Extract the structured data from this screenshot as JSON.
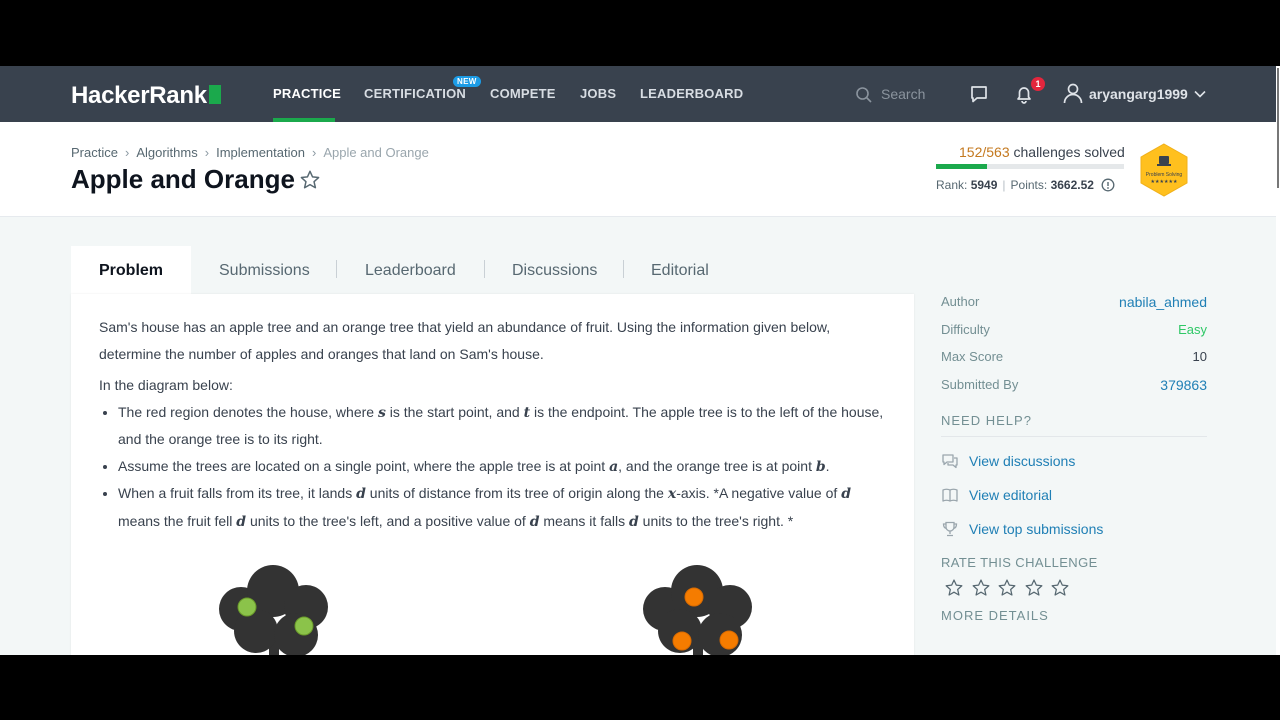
{
  "nav": {
    "logo": "HackerRank",
    "items": [
      "PRACTICE",
      "CERTIFICATION",
      "COMPETE",
      "JOBS",
      "LEADERBOARD"
    ],
    "active": "PRACTICE",
    "new_badge": "NEW",
    "search_placeholder": "Search",
    "notifications_count": "1",
    "username": "aryangarg1999"
  },
  "breadcrumb": [
    "Practice",
    "Algorithms",
    "Implementation",
    "Apple and Orange"
  ],
  "page_title": "Apple and Orange",
  "stats": {
    "solved_count": "152/563",
    "solved_label": "challenges solved",
    "progress_fraction": 0.27,
    "rank_label": "Rank:",
    "rank_value": "5949",
    "points_label": "Points:",
    "points_value": "3662.52",
    "badge_text": "Problem Solving"
  },
  "tabs": [
    "Problem",
    "Submissions",
    "Leaderboard",
    "Discussions",
    "Editorial"
  ],
  "problem": {
    "intro": "Sam's house has an apple tree and an orange tree that yield an abundance of fruit. Using the information given below, determine the number of apples and oranges that land on Sam's house.",
    "diagram_label": "In the diagram below:",
    "b1_a": "The red region denotes the house, where ",
    "b1_s": "s",
    "b1_b": " is the start point, and ",
    "b1_t": "t",
    "b1_c": " is the endpoint. The apple tree is to the left of the house, and the orange tree is to its right.",
    "b2_a": "Assume the trees are located on a single point, where the apple tree is at point ",
    "b2_av": "a",
    "b2_b": ", and the orange tree is at point ",
    "b2_bv": "b",
    "b2_c": ".",
    "b3_a": "When a fruit falls from its tree, it lands ",
    "b3_d1": "d",
    "b3_b": " units of distance from its tree of origin along the ",
    "b3_x": "x",
    "b3_c": "-axis. *A negative value of ",
    "b3_d2": "d",
    "b3_d": " means the fruit fell ",
    "b3_d3": "d",
    "b3_e": " units to the tree's left, and a positive value of ",
    "b3_d4": "d",
    "b3_f": " means it falls ",
    "b3_d5": "d",
    "b3_g": " units to the tree's right. *"
  },
  "sidebar": {
    "author_label": "Author",
    "author_value": "nabila_ahmed",
    "difficulty_label": "Difficulty",
    "difficulty_value": "Easy",
    "max_score_label": "Max Score",
    "max_score_value": "10",
    "submitted_label": "Submitted By",
    "submitted_value": "379863",
    "need_help": "NEED HELP?",
    "help_links": [
      "View discussions",
      "View editorial",
      "View top submissions"
    ],
    "rate_heading": "RATE THIS CHALLENGE",
    "rating_value": 0,
    "rating_max": 5,
    "more_details": "MORE DETAILS"
  },
  "colors": {
    "nav_bg": "#39424e",
    "accent_green": "#1ba94c",
    "link_blue": "#1f7fb5",
    "easy_green": "#2ec866",
    "solved_orange": "#c4791f",
    "badge_gold": "#ffc01e"
  }
}
